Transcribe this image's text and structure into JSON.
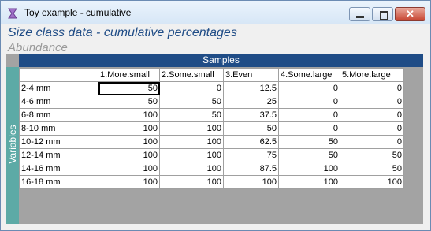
{
  "window": {
    "title": "Toy example - cumulative",
    "close_glyph": "✕"
  },
  "header": {
    "title": "Size class data - cumulative percentages",
    "subtitle": "Abundance"
  },
  "grid": {
    "samples_label": "Samples",
    "variables_label": "Variables",
    "columns": [
      "1.More.small",
      "2.Some.small",
      "3.Even",
      "4.Some.large",
      "5.More.large"
    ],
    "rows": [
      {
        "label": "2-4 mm",
        "values": [
          "50",
          "0",
          "12.5",
          "0",
          "0"
        ]
      },
      {
        "label": "4-6 mm",
        "values": [
          "50",
          "50",
          "25",
          "0",
          "0"
        ]
      },
      {
        "label": "6-8 mm",
        "values": [
          "100",
          "50",
          "37.5",
          "0",
          "0"
        ]
      },
      {
        "label": "8-10 mm",
        "values": [
          "100",
          "100",
          "50",
          "0",
          "0"
        ]
      },
      {
        "label": "10-12 mm",
        "values": [
          "100",
          "100",
          "62.5",
          "50",
          "0"
        ]
      },
      {
        "label": "12-14 mm",
        "values": [
          "100",
          "100",
          "75",
          "50",
          "50"
        ]
      },
      {
        "label": "14-16 mm",
        "values": [
          "100",
          "100",
          "87.5",
          "100",
          "50"
        ]
      },
      {
        "label": "16-18 mm",
        "values": [
          "100",
          "100",
          "100",
          "100",
          "100"
        ]
      }
    ]
  },
  "icons": {
    "app": "hourglass-icon",
    "minimize": "minimize-icon",
    "maximize": "maximize-icon",
    "close": "close-icon"
  },
  "colors": {
    "title_blue": "#1f4c86",
    "samples_bar": "#1f4c86",
    "variables_bar": "#5daaa6",
    "grid_background": "#a3a3a3"
  }
}
